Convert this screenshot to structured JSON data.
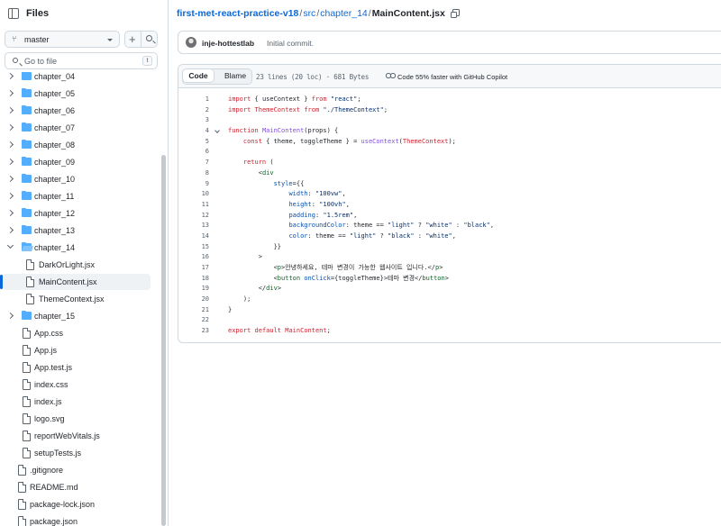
{
  "sidebar": {
    "title": "Files",
    "branch": "master",
    "go_to_file_placeholder": "Go to file",
    "go_to_file_shortcut": "t",
    "items": [
      {
        "label": "chapter_04",
        "type": "folder",
        "depth": 0,
        "expanded": false
      },
      {
        "label": "chapter_05",
        "type": "folder",
        "depth": 0,
        "expanded": false
      },
      {
        "label": "chapter_06",
        "type": "folder",
        "depth": 0,
        "expanded": false
      },
      {
        "label": "chapter_07",
        "type": "folder",
        "depth": 0,
        "expanded": false
      },
      {
        "label": "chapter_08",
        "type": "folder",
        "depth": 0,
        "expanded": false
      },
      {
        "label": "chapter_09",
        "type": "folder",
        "depth": 0,
        "expanded": false
      },
      {
        "label": "chapter_10",
        "type": "folder",
        "depth": 0,
        "expanded": false
      },
      {
        "label": "chapter_11",
        "type": "folder",
        "depth": 0,
        "expanded": false
      },
      {
        "label": "chapter_12",
        "type": "folder",
        "depth": 0,
        "expanded": false
      },
      {
        "label": "chapter_13",
        "type": "folder",
        "depth": 0,
        "expanded": false
      },
      {
        "label": "chapter_14",
        "type": "folder",
        "depth": 0,
        "expanded": true
      },
      {
        "label": "DarkOrLight.jsx",
        "type": "file",
        "depth": 1
      },
      {
        "label": "MainContent.jsx",
        "type": "file",
        "depth": 1,
        "selected": true
      },
      {
        "label": "ThemeContext.jsx",
        "type": "file",
        "depth": 1
      },
      {
        "label": "chapter_15",
        "type": "folder",
        "depth": 0,
        "expanded": false
      },
      {
        "label": "App.css",
        "type": "file",
        "depth": 0
      },
      {
        "label": "App.js",
        "type": "file",
        "depth": 0
      },
      {
        "label": "App.test.js",
        "type": "file",
        "depth": 0
      },
      {
        "label": "index.css",
        "type": "file",
        "depth": 0
      },
      {
        "label": "index.js",
        "type": "file",
        "depth": 0
      },
      {
        "label": "logo.svg",
        "type": "file",
        "depth": 0
      },
      {
        "label": "reportWebVitals.js",
        "type": "file",
        "depth": 0
      },
      {
        "label": "setupTests.js",
        "type": "file",
        "depth": 0
      },
      {
        "label": ".gitignore",
        "type": "file",
        "depth": -1
      },
      {
        "label": "README.md",
        "type": "file",
        "depth": -1
      },
      {
        "label": "package-lock.json",
        "type": "file",
        "depth": -1
      },
      {
        "label": "package.json",
        "type": "file",
        "depth": -1
      }
    ]
  },
  "breadcrumb": [
    "first-met-react-practice-v18",
    "src",
    "chapter_14",
    "MainContent.jsx"
  ],
  "breadcrumb_sep": "/",
  "commit": {
    "author": "inje-hottestlab",
    "message": "Initial commit."
  },
  "file_header": {
    "code_tab": "Code",
    "blame_tab": "Blame",
    "stats": "23 lines (20 loc) · 681 Bytes",
    "copilot": "Code 55% faster with GitHub Copilot"
  },
  "code_lines": [
    {
      "n": "1",
      "html": "<span class='kw'>import</span> { useContext } <span class='kw'>from</span> <span class='str'>\"react\"</span>;"
    },
    {
      "n": "2",
      "html": "<span class='kw'>import</span> <span class='kw'>ThemeContext</span> <span class='kw'>from</span> <span class='str'>\"./ThemeContext\"</span>;"
    },
    {
      "n": "3",
      "html": ""
    },
    {
      "n": "4",
      "fold": true,
      "html": "<span class='kw'>function</span> <span class='fn'>MainContent</span>(props) {"
    },
    {
      "n": "5",
      "html": "    <span class='kw'>const</span> { theme, toggleTheme } = <span class='fn'>useContext</span>(<span class='kw'>ThemeContext</span>);"
    },
    {
      "n": "6",
      "html": ""
    },
    {
      "n": "7",
      "html": "    <span class='kw'>return</span> ("
    },
    {
      "n": "8",
      "html": "        &lt;<span class='tag'>div</span>"
    },
    {
      "n": "9",
      "html": "            <span class='attr'>style</span>={{"
    },
    {
      "n": "10",
      "html": "                <span class='attr'>width</span>: <span class='str'>\"100vw\"</span>,"
    },
    {
      "n": "11",
      "html": "                <span class='attr'>height</span>: <span class='str'>\"100vh\"</span>,"
    },
    {
      "n": "12",
      "html": "                <span class='attr'>padding</span>: <span class='str'>\"1.5rem\"</span>,"
    },
    {
      "n": "13",
      "html": "                <span class='attr'>backgroundColor</span>: theme == <span class='str'>\"light\"</span> ? <span class='str'>\"white\"</span> : <span class='str'>\"black\"</span>,"
    },
    {
      "n": "14",
      "html": "                <span class='attr'>color</span>: theme == <span class='str'>\"light\"</span> ? <span class='str'>\"black\"</span> : <span class='str'>\"white\"</span>,"
    },
    {
      "n": "15",
      "html": "            }}"
    },
    {
      "n": "16",
      "html": "        &gt;"
    },
    {
      "n": "17",
      "html": "            &lt;<span class='tag'>p</span>&gt;안녕하세요, 테마 변경이 가능한 웹사이트 입니다.&lt;/<span class='tag'>p</span>&gt;"
    },
    {
      "n": "18",
      "html": "            &lt;<span class='tag'>button</span> <span class='attr'>onClick</span>={toggleTheme}&gt;테마 변경&lt;/<span class='tag'>button</span>&gt;"
    },
    {
      "n": "19",
      "html": "        &lt;/<span class='tag'>div</span>&gt;"
    },
    {
      "n": "20",
      "html": "    );"
    },
    {
      "n": "21",
      "html": "}"
    },
    {
      "n": "22",
      "html": ""
    },
    {
      "n": "23",
      "html": "<span class='kw'>export</span> <span class='kw'>default</span> <span class='kw'>MainContent</span>;"
    }
  ],
  "colors": {
    "accent": "#0969da",
    "folder": "#54aeff",
    "border": "#d1d9e0",
    "keyword": "#cf222e",
    "string": "#0a3069",
    "function": "#8250df",
    "tag": "#116329"
  }
}
